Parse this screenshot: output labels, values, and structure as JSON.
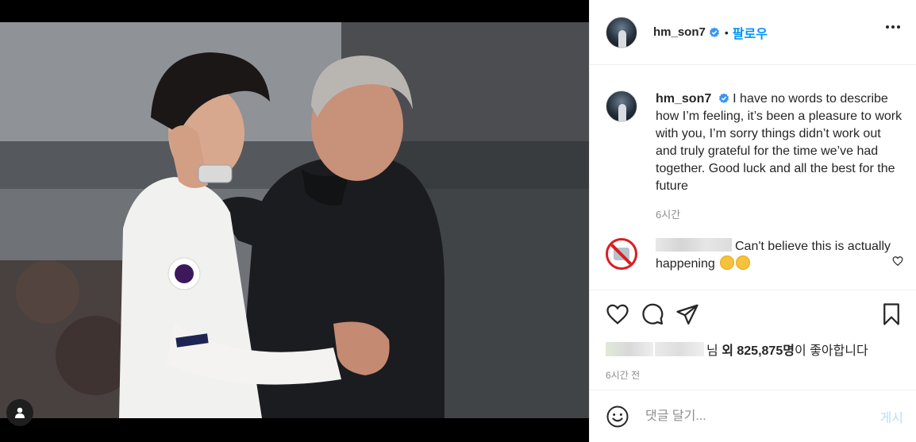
{
  "post": {
    "user_tag_icon": "person-icon"
  },
  "header": {
    "username": "hm_son7",
    "verified_icon": "verified-badge-icon",
    "separator": "•",
    "follow_label": "팔로우",
    "more_icon": "more-horizontal-icon"
  },
  "caption": {
    "username": "hm_son7",
    "text": "I have no words to describe how I’m feeling, it’s been a pleasure to work with you, I’m sorry things didn’t work out and truly grateful for the time we’ve had together. Good luck and all the best for the future",
    "time": "6시간"
  },
  "comments": [
    {
      "text_line": "Can't believe this is actually happening",
      "emojis": [
        "crying-face-emoji",
        "tears-of-joy-emoji"
      ],
      "like_icon": "heart-outline-icon"
    }
  ],
  "actions": {
    "like_icon": "heart-outline-icon",
    "comment_icon": "speech-bubble-icon",
    "share_icon": "paper-plane-icon",
    "save_icon": "bookmark-icon"
  },
  "likes": {
    "suffix_1": "님",
    "others_word": "외",
    "count": "825,875명",
    "suffix_2": "이 좋아합니다"
  },
  "post_time": "6시간 전",
  "add_comment": {
    "emoji_icon": "smiley-icon",
    "placeholder": "댓글 달기...",
    "post_label": "게시"
  },
  "colors": {
    "accent": "#0095f6",
    "text": "#262626",
    "muted": "#8e8e8e",
    "border": "#efefef",
    "post_disabled": "#b2dffc"
  }
}
